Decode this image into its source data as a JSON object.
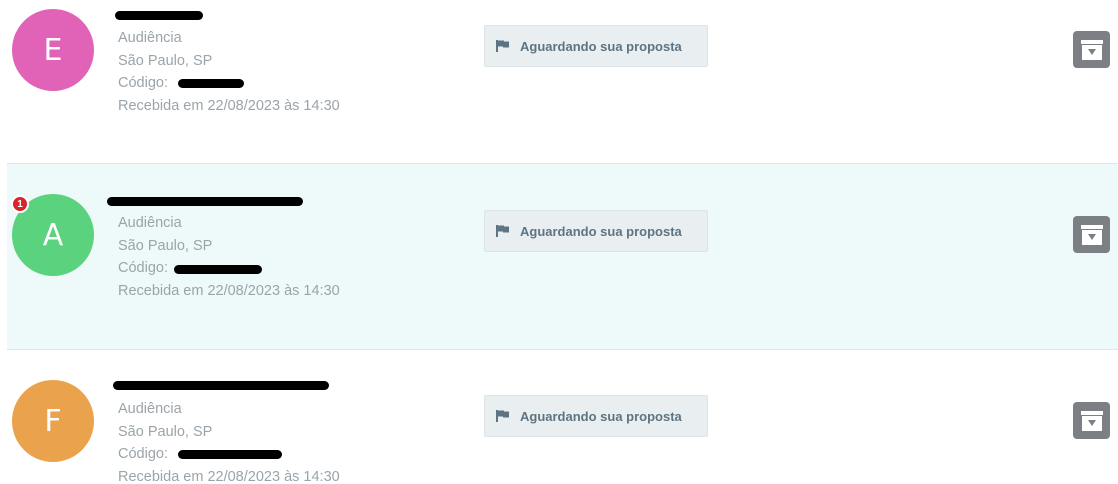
{
  "colors": {
    "avatar_e": "#e163b7",
    "avatar_a": "#5ad27e",
    "avatar_f": "#eba24c",
    "row_highlight": "#eef9fa",
    "status_bg": "#e9eef1",
    "status_text": "#5d7482",
    "meta_text": "#9aa4aa",
    "action_button": "#7c7f83",
    "notification_badge": "#d9262c"
  },
  "items": [
    {
      "avatar_letter": "E",
      "type": "Audiência",
      "location": "São Paulo, SP",
      "code_label": "Código:",
      "received": "Recebida em 22/08/2023 às 14:30",
      "status_icon": "flag-icon",
      "status": "Aguardando sua proposta",
      "action_icon": "download-box-icon"
    },
    {
      "avatar_letter": "A",
      "notification_count": "1",
      "type": "Audiência",
      "location": "São Paulo, SP",
      "code_label": "Código:",
      "received": "Recebida em 22/08/2023 às 14:30",
      "status_icon": "flag-icon",
      "status": "Aguardando sua proposta",
      "action_icon": "download-box-icon"
    },
    {
      "avatar_letter": "F",
      "type": "Audiência",
      "location": "São Paulo, SP",
      "code_label": "Código:",
      "received": "Recebida em 22/08/2023 às 14:30",
      "status_icon": "flag-icon",
      "status": "Aguardando sua proposta",
      "action_icon": "download-box-icon"
    }
  ]
}
